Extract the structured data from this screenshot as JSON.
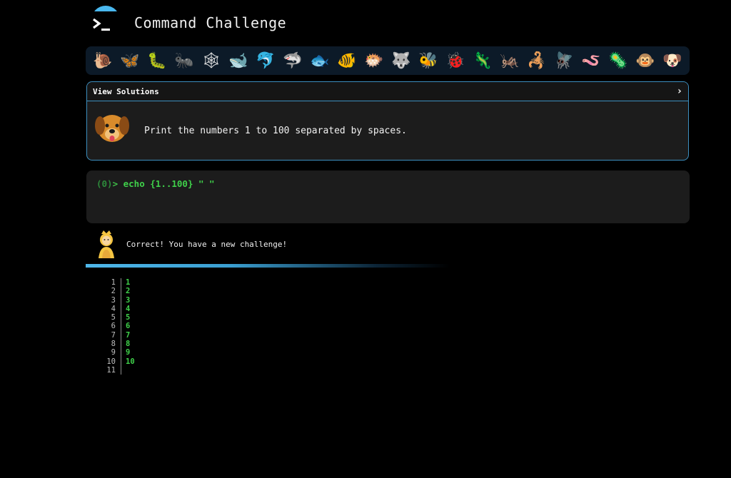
{
  "app": {
    "title": "Command Challenge"
  },
  "animals": [
    {
      "name": "snail",
      "glyph": "🐌"
    },
    {
      "name": "butterfly",
      "glyph": "🦋"
    },
    {
      "name": "caterpillar",
      "glyph": "🐛"
    },
    {
      "name": "ant",
      "glyph": "🐜"
    },
    {
      "name": "spider-web",
      "glyph": "🕸"
    },
    {
      "name": "whale",
      "glyph": "🐋"
    },
    {
      "name": "dolphin",
      "glyph": "🐬"
    },
    {
      "name": "shark",
      "glyph": "🦈"
    },
    {
      "name": "fish",
      "glyph": "🐟"
    },
    {
      "name": "tropical-fish",
      "glyph": "🐠"
    },
    {
      "name": "blowfish",
      "glyph": "🐡"
    },
    {
      "name": "wolf",
      "glyph": "🐺"
    },
    {
      "name": "bee",
      "glyph": "🐝"
    },
    {
      "name": "ladybug",
      "glyph": "🐞"
    },
    {
      "name": "lizard",
      "glyph": "🦎"
    },
    {
      "name": "cricket",
      "glyph": "🦗"
    },
    {
      "name": "scorpion",
      "glyph": "🦂"
    },
    {
      "name": "fly",
      "glyph": "🪰"
    },
    {
      "name": "worm",
      "glyph": "🪱"
    },
    {
      "name": "microbe",
      "glyph": "🦠"
    },
    {
      "name": "monkey",
      "glyph": "🐵"
    },
    {
      "name": "dog",
      "glyph": "🐶"
    }
  ],
  "challenge": {
    "header_label": "View Solutions",
    "text": "Print the numbers 1 to 100 separated by spaces."
  },
  "terminal": {
    "count": "(0)",
    "prompt": ">",
    "command": " echo {1..100} \" \""
  },
  "feedback": {
    "message": "Correct! You have a new challenge!"
  },
  "output": {
    "lines": [
      {
        "n": "1",
        "v": "1"
      },
      {
        "n": "2",
        "v": "2"
      },
      {
        "n": "3",
        "v": "3"
      },
      {
        "n": "4",
        "v": "4"
      },
      {
        "n": "5",
        "v": "5"
      },
      {
        "n": "6",
        "v": "6"
      },
      {
        "n": "7",
        "v": "7"
      },
      {
        "n": "8",
        "v": "8"
      },
      {
        "n": "9",
        "v": "9"
      },
      {
        "n": "10",
        "v": "10"
      },
      {
        "n": "11",
        "v": ""
      }
    ]
  },
  "colors": {
    "accent": "#49b8ef",
    "card_border": "#3d8fbf",
    "terminal_green": "#3fd04a"
  }
}
